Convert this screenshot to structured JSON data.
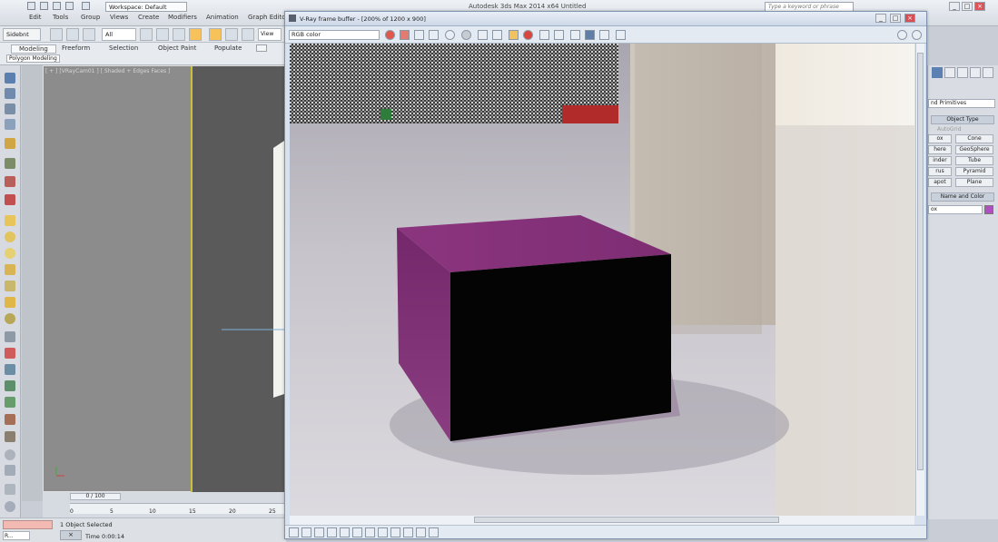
{
  "app": {
    "window_title": "Autodesk 3ds Max 2014 x64   Untitled",
    "workspace_selector": "Workspace: Default",
    "search_placeholder": "Type a keyword or phrase",
    "menu": [
      "Edit",
      "Tools",
      "Group",
      "Views",
      "Create",
      "Modifiers",
      "Animation",
      "Graph Editors"
    ]
  },
  "toolbar": {
    "filter": "All",
    "selectset": "Sidebnt",
    "view_dropdown": "View"
  },
  "ribbon": {
    "tabs": [
      "Modeling",
      "Freeform",
      "Selection",
      "Object Paint",
      "Populate"
    ],
    "subtab": "Polygon Modeling"
  },
  "viewport": {
    "label": "[ + ] [VRayCam01 ] [ Shaded + Edges Faces ]"
  },
  "timeline": {
    "frame_counter": "0 / 100",
    "ticks": [
      "0",
      "5",
      "10",
      "15",
      "20",
      "25"
    ]
  },
  "status": {
    "selection": "1 Object Selected",
    "time": "Time  0:00:14",
    "script_button": "R..."
  },
  "vfb": {
    "title": "V-Ray frame buffer - [200% of 1200 x 900]",
    "channel": "RGB color"
  },
  "command_panel": {
    "category": "nd Primitives",
    "object_type_title": "Object Type",
    "autogrid": "AutoGrid",
    "buttons": [
      [
        "ox",
        "Cone"
      ],
      [
        "here",
        "GeoSphere"
      ],
      [
        "inder",
        "Tube"
      ],
      [
        "rus",
        "Pyramid"
      ],
      [
        "apot",
        "Plane"
      ]
    ],
    "name_color_title": "Name and Color",
    "name_value": "ox",
    "swatch_color": "#b04fc0"
  },
  "colors": {
    "cube_top": "#85307c",
    "cube_left": "#7d2b72",
    "cube_front": "#050505",
    "render_floor": "#c9c6cc"
  }
}
